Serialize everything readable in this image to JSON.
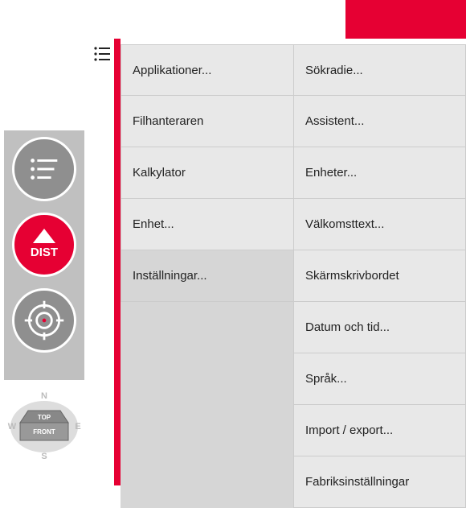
{
  "colors": {
    "accent": "#e60033",
    "panel": "#e8e8e8",
    "panel_selected": "#d6d6d6",
    "sidebar": "#c0c0c0"
  },
  "sidebar": {
    "buttons": [
      {
        "name": "list-button",
        "icon": "list-icon"
      },
      {
        "name": "dist-button",
        "icon": "dist-icon",
        "label": "DIST"
      },
      {
        "name": "target-button",
        "icon": "target-icon"
      }
    ]
  },
  "nav_cube": {
    "top_label": "TOP",
    "front_label": "FRONT",
    "compass": {
      "n": "N",
      "e": "E",
      "s": "S",
      "w": "W"
    }
  },
  "menu": {
    "left": [
      {
        "label": "Applikationer..."
      },
      {
        "label": "Filhanteraren"
      },
      {
        "label": "Kalkylator"
      },
      {
        "label": "Enhet..."
      },
      {
        "label": "Inställningar...",
        "selected": true
      }
    ],
    "right": [
      {
        "label": "Sökradie..."
      },
      {
        "label": "Assistent..."
      },
      {
        "label": "Enheter..."
      },
      {
        "label": "Välkomsttext..."
      },
      {
        "label": "Skärmskrivbordet"
      },
      {
        "label": "Datum och tid..."
      },
      {
        "label": "Språk..."
      },
      {
        "label": "Import / export..."
      },
      {
        "label": "Fabriksinställningar"
      }
    ]
  }
}
